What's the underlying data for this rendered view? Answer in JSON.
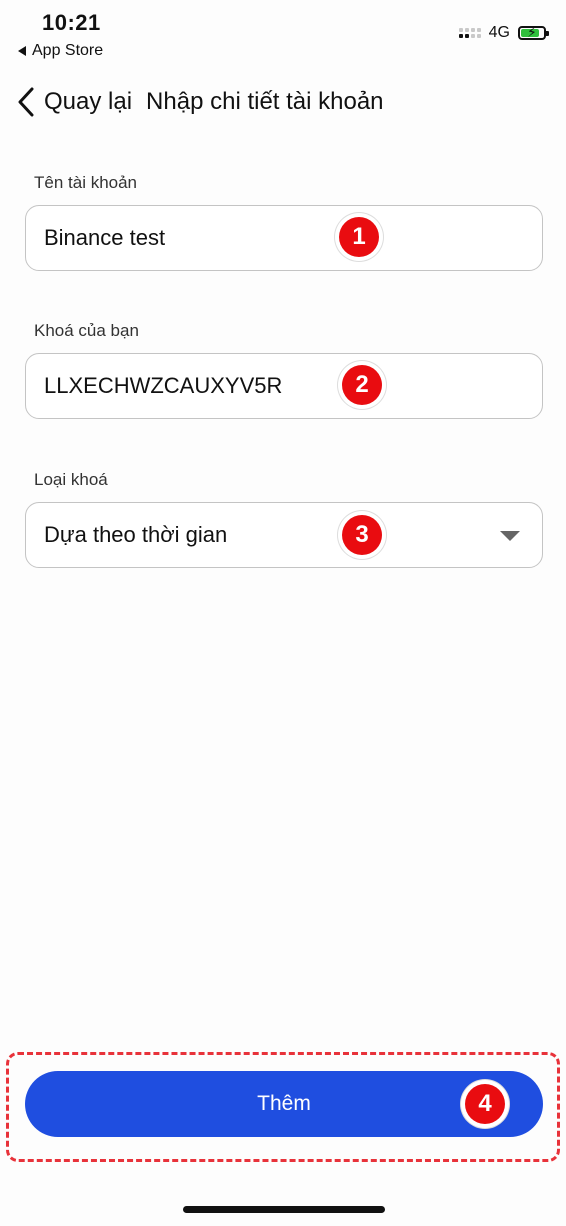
{
  "status_bar": {
    "time": "10:21",
    "back_app": "App Store",
    "network": "4G"
  },
  "header": {
    "back_label": "Quay lại",
    "title": "Nhập chi tiết tài khoản"
  },
  "form": {
    "account_name": {
      "label": "Tên tài khoản",
      "value": "Binance test"
    },
    "key": {
      "label": "Khoá của bạn",
      "value": "LLXECHWZCAUXYV5R"
    },
    "key_type": {
      "label": "Loại khoá",
      "value": "Dựa theo thời gian"
    }
  },
  "steps": [
    "1",
    "2",
    "3",
    "4"
  ],
  "actions": {
    "add_label": "Thêm"
  },
  "colors": {
    "primary": "#1f4ee0",
    "marker": "#e90c10",
    "highlight": "#e8323a",
    "battery": "#2fbf3c"
  }
}
